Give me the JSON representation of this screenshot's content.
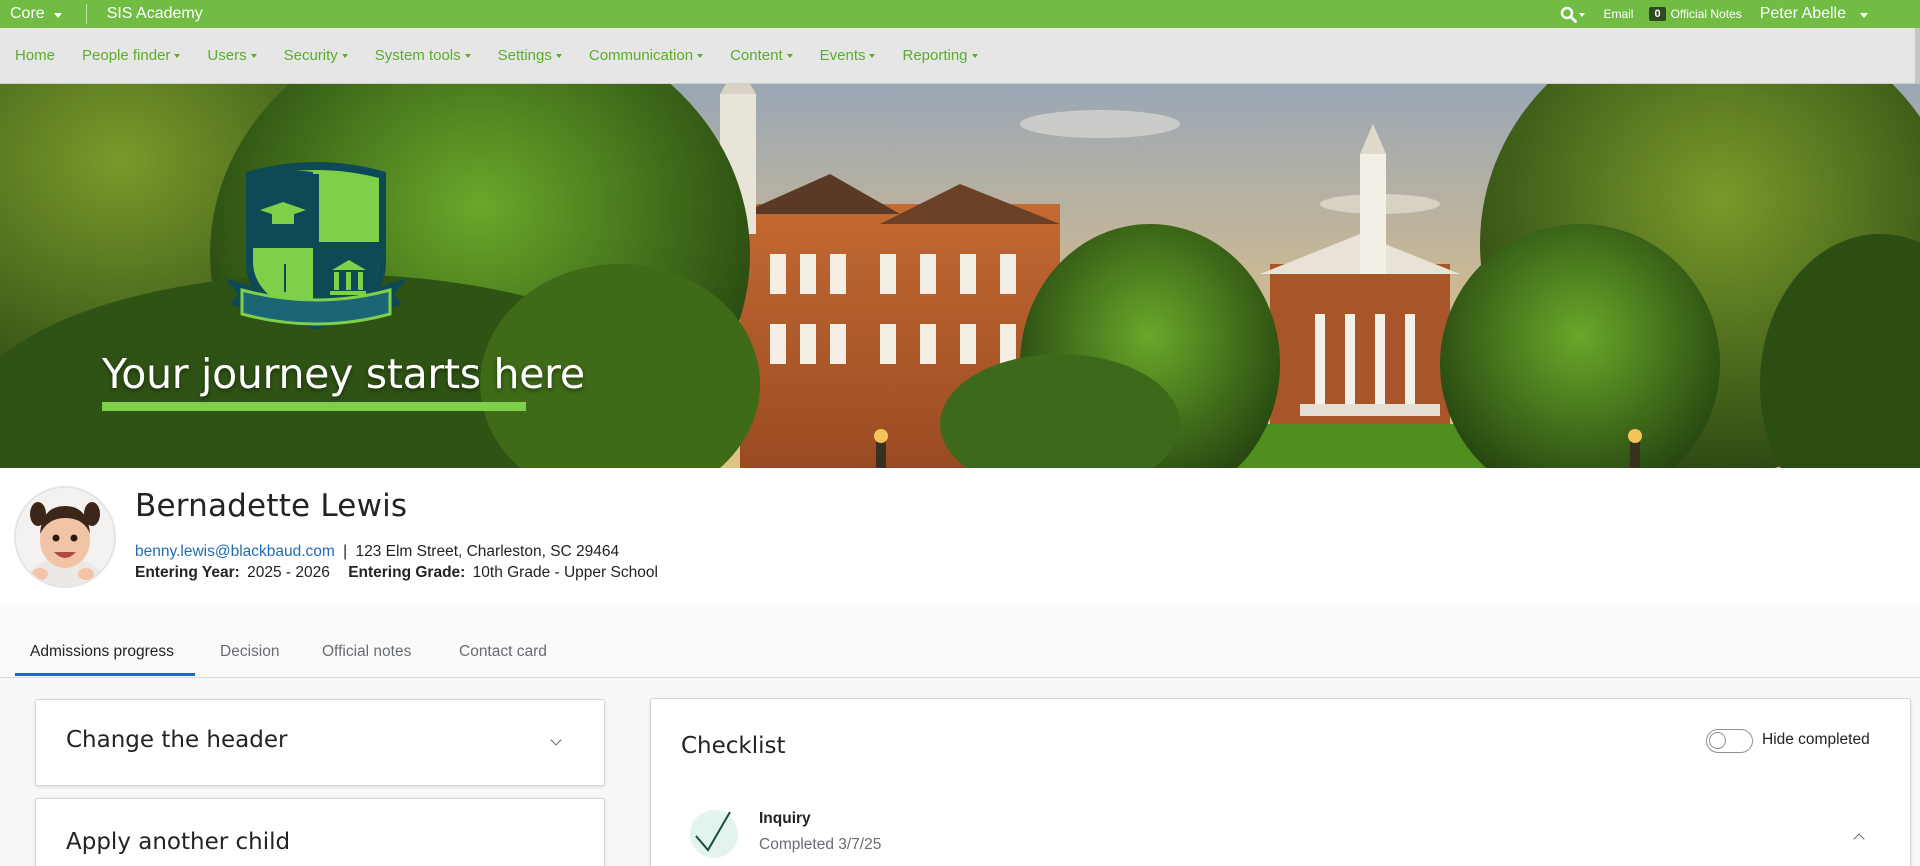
{
  "topbar": {
    "app_switcher": "Core",
    "school_name": "SIS Academy",
    "email_label": "Email",
    "official_notes_count": "0",
    "official_notes_label": "Official Notes",
    "user_name": "Peter Abelle"
  },
  "nav": {
    "items": [
      {
        "label": "Home",
        "dropdown": false
      },
      {
        "label": "People finder",
        "dropdown": true
      },
      {
        "label": "Users",
        "dropdown": true
      },
      {
        "label": "Security",
        "dropdown": true
      },
      {
        "label": "System tools",
        "dropdown": true
      },
      {
        "label": "Settings",
        "dropdown": true
      },
      {
        "label": "Communication",
        "dropdown": true
      },
      {
        "label": "Content",
        "dropdown": true
      },
      {
        "label": "Events",
        "dropdown": true
      },
      {
        "label": "Reporting",
        "dropdown": true
      }
    ]
  },
  "hero": {
    "tagline": "Your journey starts here"
  },
  "profile": {
    "name": "Bernadette Lewis",
    "email": "benny.lewis@blackbaud.com",
    "separator": "|",
    "address": "123 Elm Street, Charleston, SC 29464",
    "entering_year_label": "Entering Year:",
    "entering_year": "2025 - 2026",
    "entering_grade_label": "Entering Grade:",
    "entering_grade": "10th Grade - Upper School"
  },
  "tabs": [
    {
      "label": "Admissions progress",
      "active": true
    },
    {
      "label": "Decision",
      "active": false
    },
    {
      "label": "Official notes",
      "active": false
    },
    {
      "label": "Contact card",
      "active": false
    }
  ],
  "left_panels": {
    "change_header": "Change the header",
    "apply_child": "Apply another child"
  },
  "checklist": {
    "title": "Checklist",
    "hide_completed_label": "Hide completed",
    "hide_completed_on": false,
    "items": [
      {
        "title": "Inquiry",
        "status": "Completed 3/7/25"
      }
    ]
  },
  "colors": {
    "brand_green": "#71bd44",
    "nav_link": "#5aae28",
    "link_blue": "#1f6cb8",
    "check_bg": "#e3f4ee"
  },
  "icons": {
    "search": "search-icon",
    "caret": "caret-down-icon",
    "check": "checkmark-icon",
    "crest": "school-crest-logo"
  }
}
